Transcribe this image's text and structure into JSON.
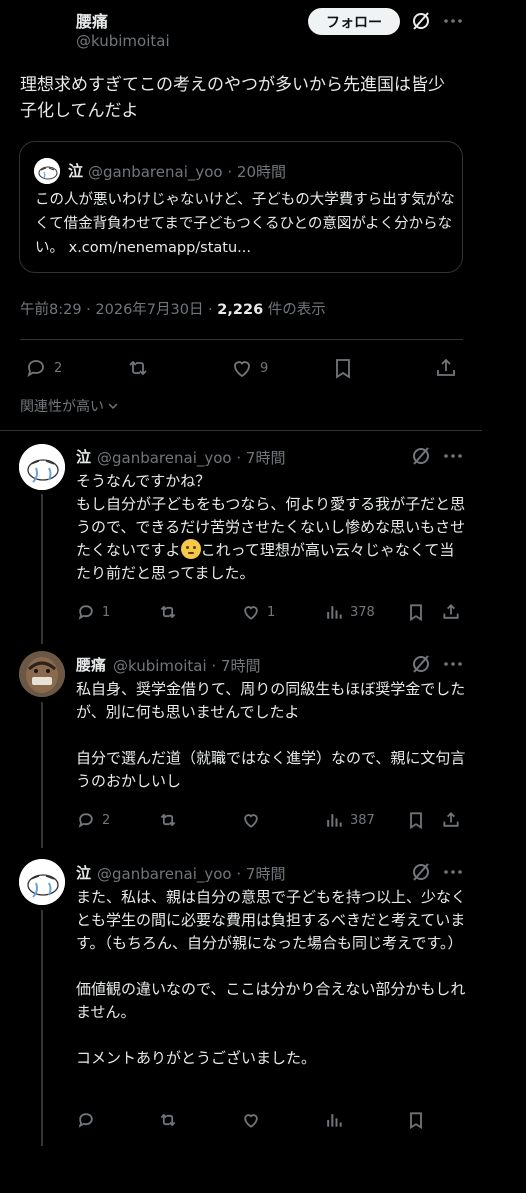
{
  "main_tweet": {
    "author_name": "腰痛",
    "author_handle": "@kubimoitai",
    "follow_label": "フォロー",
    "text": "理想求めすぎてこの考えのやつが多いから先進国は皆少子化してんだよ",
    "quote": {
      "name": "泣",
      "handle_time": "@ganbarenai_yoo · 20時間",
      "text": "この人が悪いわけじゃないけど、子どもの大学費すら出す気がなくて借金背負わせてまで子どもつくるひとの意図がよく分からない。 x.com/nenemapp/statu..."
    },
    "timestamp": "午前8:29 · 2026年7月30日 · ",
    "views": "2,226",
    "views_label": " 件の表示",
    "reply_count": "2",
    "like_count": "9"
  },
  "sort_label": "関連性が高い",
  "replies": [
    {
      "name": "泣",
      "meta": "@ganbarenai_yoo · 7時間",
      "text_a": "そうなんですかね？\nもし自分が子どもをもつなら、何より愛する我が子だと思うので、できるだけ苦労させたくないし惨めな思いもさせたくないですよ",
      "text_b": "これって理想が高い云々じゃなくて当たり前だと思ってました。",
      "replies": "1",
      "likes": "1",
      "views": "378"
    },
    {
      "name": "腰痛",
      "meta": "@kubimoitai · 7時間",
      "text": "私自身、奨学金借りて、周りの同級生もほぼ奨学金でしたが、別に何も思いませんでしたよ\n\n自分で選んだ道（就職ではなく進学）なので、親に文句言うのおかしいし",
      "replies": "2",
      "views": "387"
    },
    {
      "name": "泣",
      "meta": "@ganbarenai_yoo · 7時間",
      "text": "また、私は、親は自分の意思で子どもを持つ以上、少なくとも学生の間に必要な費用は負担するべきだと考えています。（もちろん、自分が親になった場合も同じ考えです。）\n\n価値観の違いなので、ここは分かり合えない部分かもしれません。\n\nコメントありがとうございました。"
    }
  ]
}
